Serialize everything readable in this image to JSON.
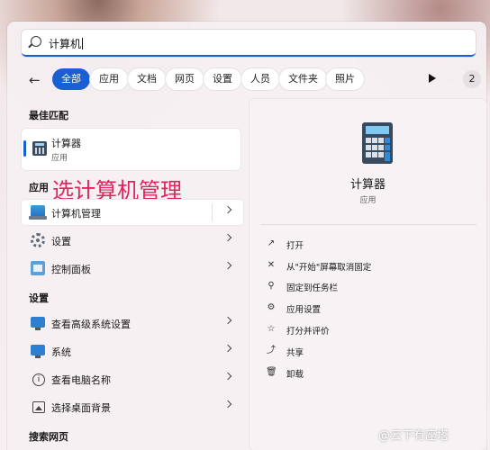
{
  "search": {
    "query": "计算机"
  },
  "filters": {
    "chips": [
      "全部",
      "应用",
      "文档",
      "网页",
      "设置",
      "人员",
      "文件夹",
      "照片"
    ],
    "count": "2"
  },
  "left": {
    "best_match_title": "最佳匹配",
    "best_match": {
      "name": "计算器",
      "type": "应用"
    },
    "apps_title": "应用",
    "annotation": "选计算机管理",
    "apps": [
      "计算机管理",
      "设置",
      "控制面板"
    ],
    "settings_title": "设置",
    "settings": [
      "查看高级系统设置",
      "系统",
      "查看电脑名称",
      "选择桌面背景"
    ],
    "web_title": "搜索网页"
  },
  "detail": {
    "name": "计算器",
    "type": "应用",
    "actions": [
      "打开",
      "从\"开始\"屏幕取消固定",
      "固定到任务栏",
      "应用设置",
      "打分并评价",
      "共享",
      "卸载"
    ]
  },
  "watermark": "@云下有座塔"
}
